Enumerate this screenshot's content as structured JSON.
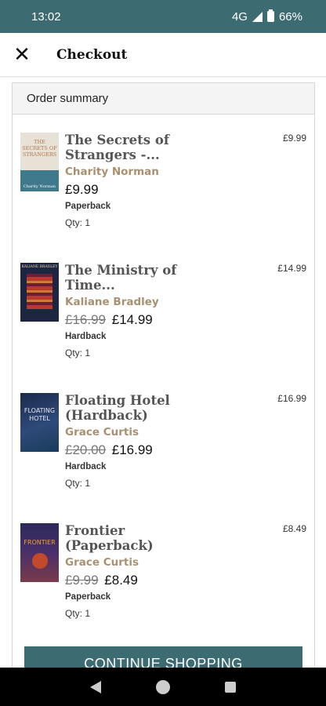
{
  "status": {
    "time": "13:02",
    "network": "4G",
    "battery": "66%"
  },
  "app_bar": {
    "title": "Checkout",
    "close_icon": "close-icon"
  },
  "summary": {
    "header": "Order summary",
    "items": [
      {
        "title_line1": "The Secrets of",
        "title_line2": "Strangers -...",
        "author": "Charity Norman",
        "old_price": "",
        "price": "£9.99",
        "format": "Paperback",
        "qty": "Qty: 1",
        "line_total": "£9.99",
        "cover_text": "THE SECRETS OF STRANGERS",
        "cover_author": "Charity Norman"
      },
      {
        "title_line1": "The Ministry of",
        "title_line2": "Time...",
        "author": "Kaliane Bradley",
        "old_price": "£16.99",
        "price": "£14.99",
        "format": "Hardback",
        "qty": "Qty: 1",
        "line_total": "£14.99",
        "cover_text": "KALIANE BRADLEY",
        "cover_author": ""
      },
      {
        "title_line1": "Floating Hotel",
        "title_line2": "(Hardback)",
        "author": "Grace Curtis",
        "old_price": "£20.00",
        "price": "£16.99",
        "format": "Hardback",
        "qty": "Qty: 1",
        "line_total": "£16.99",
        "cover_text": "FLOATING HOTEL",
        "cover_author": ""
      },
      {
        "title_line1": "Frontier",
        "title_line2": "(Paperback)",
        "author": "Grace Curtis",
        "old_price": "£9.99",
        "price": "£8.49",
        "format": "Paperback",
        "qty": "Qty: 1",
        "line_total": "£8.49",
        "cover_text": "FRONTIER",
        "cover_author": ""
      }
    ]
  },
  "continue_button": "CONTINUE SHOPPING",
  "colors": {
    "brand": "#3d6b72",
    "author": "#a89070"
  }
}
